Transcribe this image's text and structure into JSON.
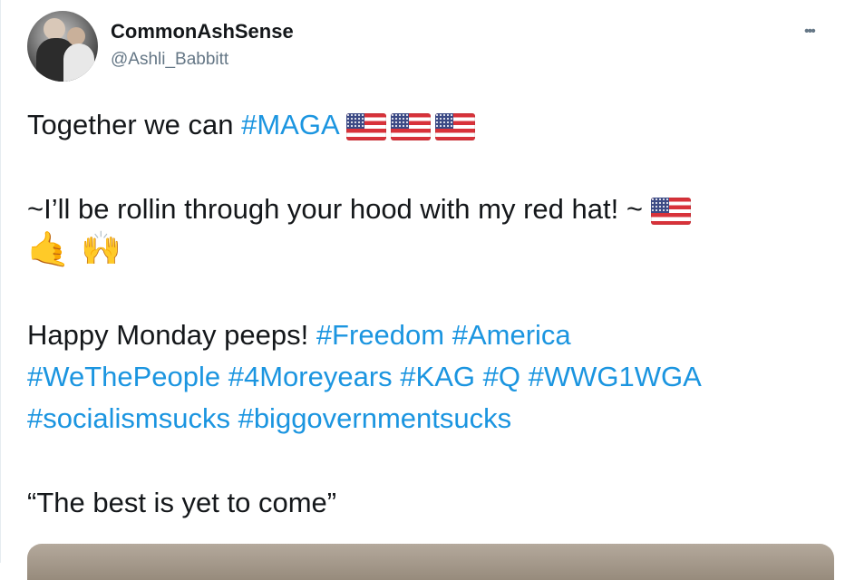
{
  "tweet": {
    "display_name": "CommonAshSense",
    "handle": "@Ashli_Babbitt",
    "more_icon": "•••",
    "line1_text": "Together we can ",
    "line1_tag": "#MAGA",
    "line2_text": "~I’ll be rollin through your hood with my red hat! ~ ",
    "line3_emoji_1": "🤙",
    "line3_emoji_2": "🙌",
    "line4_text": "Happy Monday peeps! ",
    "tags_line4": [
      "#Freedom",
      "#America"
    ],
    "tags_line5": [
      "#WeThePeople",
      "#4Moreyears",
      "#KAG",
      "#Q",
      "#WWG1WGA"
    ],
    "tags_line6": [
      "#socialismsucks",
      "#biggovernmentsucks"
    ],
    "quote": "“The best is yet to come”"
  },
  "icons": [
    "avatar",
    "more-icon",
    "flag-us-icon",
    "call-me-hand-icon",
    "raising-hands-icon"
  ],
  "colors": {
    "text": "#14171a",
    "secondary": "#657786",
    "link": "#1b95e0"
  }
}
